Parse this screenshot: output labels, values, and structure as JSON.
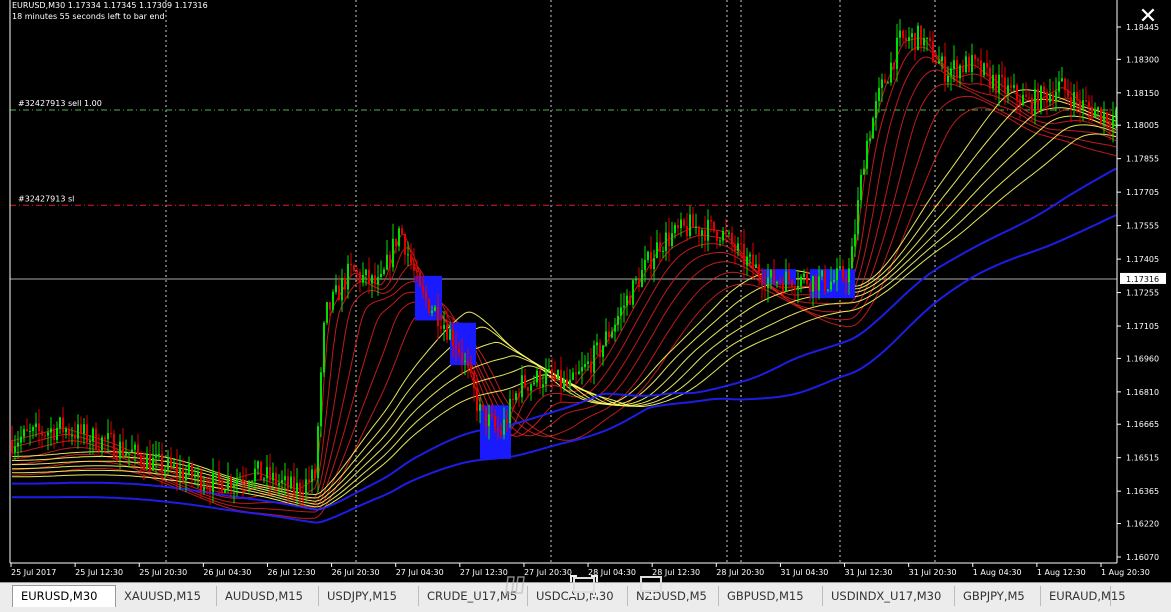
{
  "window": {
    "header_line1": "EURUSD,M30  1.17334 1.17345 1.17309 1.17316",
    "header_line2": "18 minutes 55 seconds left to bar end",
    "close_icon": "close-icon"
  },
  "chart_data": {
    "type": "candlestick",
    "symbol": "EURUSD",
    "timeframe": "M30",
    "current_price": "1.17316",
    "price_ticks": [
      "1.18445",
      "1.18300",
      "1.18150",
      "1.18005",
      "1.17855",
      "1.17705",
      "1.17555",
      "1.17405",
      "1.17255",
      "1.17105",
      "1.16960",
      "1.16810",
      "1.16665",
      "1.16515",
      "1.16365",
      "1.16220",
      "1.16070"
    ],
    "time_labels": [
      "25 Jul 2017",
      "25 Jul 12:30",
      "25 Jul 20:30",
      "26 Jul 04:30",
      "26 Jul 12:30",
      "26 Jul 20:30",
      "27 Jul 04:30",
      "27 Jul 12:30",
      "27 Jul 20:30",
      "28 Jul 04:30",
      "28 Jul 12:30",
      "28 Jul 20:30",
      "31 Jul 04:30",
      "31 Jul 12:30",
      "31 Jul 20:30",
      "1 Aug 04:30",
      "1 Aug 12:30",
      "1 Aug 20:30"
    ],
    "order_lines": [
      {
        "label": "#32427913 sell 1.00",
        "price": 1.18073,
        "color": "#4caf50"
      },
      {
        "label": "#32427913 sl",
        "price": 1.17646,
        "color": "#e02020"
      }
    ],
    "ylim": [
      1.1602,
      1.1852
    ],
    "trend_anchor": [
      [
        0,
        1.1658
      ],
      [
        60,
        1.1665
      ],
      [
        110,
        1.1658
      ],
      [
        160,
        1.1648
      ],
      [
        215,
        1.164
      ],
      [
        255,
        1.1645
      ],
      [
        295,
        1.1637
      ],
      [
        315,
        1.1643
      ],
      [
        325,
        1.1715
      ],
      [
        350,
        1.1735
      ],
      [
        380,
        1.1728
      ],
      [
        400,
        1.1755
      ],
      [
        420,
        1.1725
      ],
      [
        440,
        1.1715
      ],
      [
        460,
        1.17
      ],
      [
        480,
        1.1672
      ],
      [
        500,
        1.1662
      ],
      [
        520,
        1.1684
      ],
      [
        545,
        1.1688
      ],
      [
        570,
        1.1683
      ],
      [
        600,
        1.17
      ],
      [
        630,
        1.1725
      ],
      [
        660,
        1.1748
      ],
      [
        690,
        1.1755
      ],
      [
        720,
        1.1753
      ],
      [
        745,
        1.174
      ],
      [
        770,
        1.1731
      ],
      [
        800,
        1.1732
      ],
      [
        830,
        1.173
      ],
      [
        850,
        1.1735
      ],
      [
        865,
        1.179
      ],
      [
        880,
        1.1815
      ],
      [
        900,
        1.1838
      ],
      [
        920,
        1.184
      ],
      [
        945,
        1.1825
      ],
      [
        970,
        1.1828
      ],
      [
        1000,
        1.1818
      ],
      [
        1030,
        1.181
      ],
      [
        1060,
        1.1818
      ],
      [
        1080,
        1.181
      ],
      [
        1118,
        1.1803
      ]
    ],
    "ma_groups": [
      {
        "color": "#e02020",
        "offsets": [
          0.0,
          -0.0004,
          -0.0008,
          -0.0012,
          -0.0016,
          -0.002,
          -0.0024
        ],
        "smooth": [
          3,
          6,
          10,
          15,
          20,
          26,
          32
        ]
      },
      {
        "color": "#ffff66",
        "offsets": [
          -0.001,
          -0.0013,
          -0.0016,
          -0.0019,
          -0.0022,
          -0.0025
        ],
        "smooth": [
          50,
          55,
          60,
          65,
          70,
          75
        ]
      },
      {
        "color": "#2020ff",
        "offsets": [
          -0.003,
          -0.004
        ],
        "smooth": [
          95,
          110
        ]
      }
    ],
    "highlight_boxes": [
      {
        "x0": 415,
        "x1": 442,
        "p_hi": 1.1733,
        "p_lo": 1.1713
      },
      {
        "x0": 450,
        "x1": 476,
        "p_hi": 1.1712,
        "p_lo": 1.1693
      },
      {
        "x0": 480,
        "x1": 511,
        "p_hi": 1.1675,
        "p_lo": 1.1651
      },
      {
        "x0": 762,
        "x1": 796,
        "p_hi": 1.1736,
        "p_lo": 1.1729
      },
      {
        "x0": 810,
        "x1": 855,
        "p_hi": 1.1736,
        "p_lo": 1.1723
      }
    ],
    "vline_positions": [
      166,
      356,
      551,
      727,
      741,
      840,
      935
    ],
    "colors": {
      "up": "#00e000",
      "down": "#e00000",
      "grid": "#cccccc",
      "axis": "#ffffff"
    }
  },
  "tabs": [
    {
      "label": "EURUSD,M30",
      "active": true
    },
    {
      "label": "XAUUSD,M15",
      "active": false
    },
    {
      "label": "AUDUSD,M15",
      "active": false
    },
    {
      "label": "USDJPY,M15",
      "active": false
    },
    {
      "label": "CRUDE_U17,M5",
      "active": false
    },
    {
      "label": "USDCAD,M30",
      "active": false
    },
    {
      "label": "NZDUSD,M5",
      "active": false
    },
    {
      "label": "GBPUSD,M15",
      "active": false
    },
    {
      "label": "USDINDX_U17,M30",
      "active": false
    },
    {
      "label": "GBPJPY,M5",
      "active": false
    },
    {
      "label": "EURAUD,M15",
      "active": false
    }
  ]
}
